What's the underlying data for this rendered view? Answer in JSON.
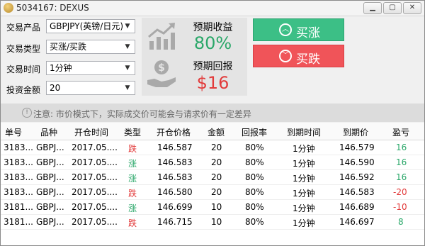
{
  "window": {
    "title": "5034167: DEXUS"
  },
  "form": {
    "product_label": "交易产品",
    "product_value": "GBPJPY(英镑/日元)",
    "type_label": "交易类型",
    "type_value": "买涨/买跌",
    "time_label": "交易时间",
    "time_value": "1分钟",
    "amount_label": "投资金额",
    "amount_value": "20"
  },
  "info": {
    "expected_yield_label": "预期收益",
    "expected_yield_value": "80%",
    "expected_return_label": "预期回报",
    "expected_return_value": "$16"
  },
  "buttons": {
    "buy_up": "买涨",
    "buy_down": "买跌"
  },
  "notice": {
    "text": "注意: 市价模式下，实际成交价可能会与请求价有一定差异"
  },
  "table": {
    "headers": [
      "单号",
      "品种",
      "开仓时间",
      "类型",
      "开仓价格",
      "金额",
      "回报率",
      "到期时间",
      "到期价",
      "盈亏"
    ],
    "rows": [
      {
        "id": "3183...",
        "symbol": "GBPJ...",
        "open_time": "2017.05....",
        "type": "跌",
        "price": "146.587",
        "amount": "20",
        "rate": "80%",
        "expiry": "1分钟",
        "close_price": "146.579",
        "pnl": "16"
      },
      {
        "id": "3183...",
        "symbol": "GBPJ...",
        "open_time": "2017.05....",
        "type": "涨",
        "price": "146.583",
        "amount": "20",
        "rate": "80%",
        "expiry": "1分钟",
        "close_price": "146.590",
        "pnl": "16"
      },
      {
        "id": "3183...",
        "symbol": "GBPJ...",
        "open_time": "2017.05....",
        "type": "涨",
        "price": "146.583",
        "amount": "20",
        "rate": "80%",
        "expiry": "1分钟",
        "close_price": "146.592",
        "pnl": "16"
      },
      {
        "id": "3183...",
        "symbol": "GBPJ...",
        "open_time": "2017.05....",
        "type": "跌",
        "price": "146.580",
        "amount": "20",
        "rate": "80%",
        "expiry": "1分钟",
        "close_price": "146.583",
        "pnl": "-20"
      },
      {
        "id": "3181...",
        "symbol": "GBPJ...",
        "open_time": "2017.05....",
        "type": "涨",
        "price": "146.699",
        "amount": "10",
        "rate": "80%",
        "expiry": "1分钟",
        "close_price": "146.689",
        "pnl": "-10"
      },
      {
        "id": "3181...",
        "symbol": "GBPJ...",
        "open_time": "2017.05....",
        "type": "跌",
        "price": "146.715",
        "amount": "10",
        "rate": "80%",
        "expiry": "1分钟",
        "close_price": "146.697",
        "pnl": "8"
      }
    ]
  },
  "colors": {
    "up": "#3cbf86",
    "down": "#f05459",
    "yield": "#2aa769",
    "return": "#e23a3a"
  },
  "icons": [
    "app-icon",
    "minimize-icon",
    "maximize-icon",
    "close-icon",
    "chevron-down-icon",
    "chart-growth-icon",
    "money-hand-icon",
    "arrow-up-circle-icon",
    "arrow-down-circle-icon",
    "info-icon"
  ]
}
